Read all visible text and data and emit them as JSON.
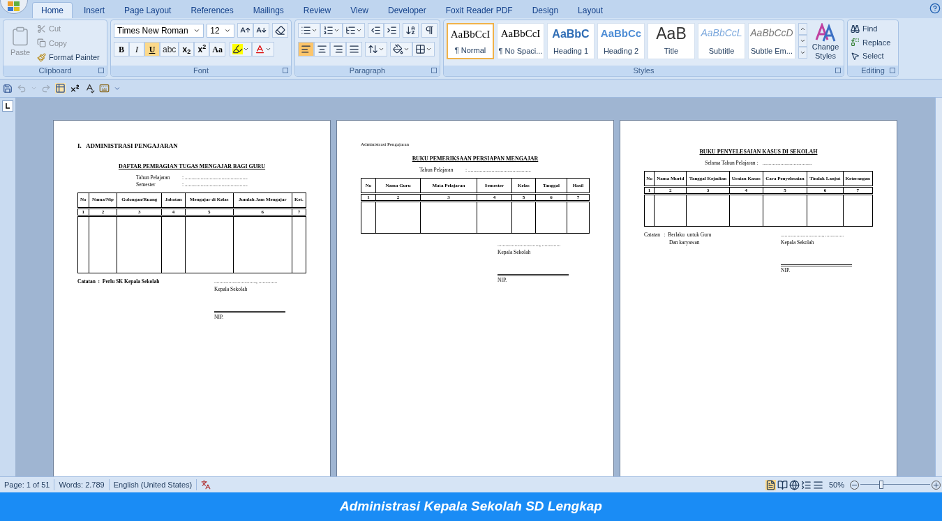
{
  "tabs": [
    {
      "label": "Home",
      "selected": true
    },
    {
      "label": "Insert",
      "selected": false
    },
    {
      "label": "Page Layout",
      "selected": false
    },
    {
      "label": "References",
      "selected": false
    },
    {
      "label": "Mailings",
      "selected": false
    },
    {
      "label": "Review",
      "selected": false
    },
    {
      "label": "View",
      "selected": false
    },
    {
      "label": "Developer",
      "selected": false
    },
    {
      "label": "Foxit Reader PDF",
      "selected": false
    },
    {
      "label": "Design",
      "selected": false
    },
    {
      "label": "Layout",
      "selected": false
    }
  ],
  "clipboard": {
    "paste": "Paste",
    "cut": "Cut",
    "copy": "Copy",
    "format_painter": "Format Painter",
    "label": "Clipboard"
  },
  "font": {
    "font_name": "Times New Roman",
    "font_size": "12",
    "label": "Font",
    "buttons": [
      {
        "kind": "bold",
        "label": "B",
        "selected": false
      },
      {
        "kind": "italic",
        "label": "I",
        "selected": false
      },
      {
        "kind": "underline",
        "label": "U",
        "selected": true
      },
      {
        "kind": "strike",
        "label": "abc",
        "selected": false
      },
      {
        "kind": "sub",
        "label": "x$_{2}$",
        "selected": false
      },
      {
        "kind": "sup",
        "label": "x$^{2}$",
        "selected": false
      },
      {
        "kind": "case",
        "label": "Aa",
        "selected": false
      }
    ]
  },
  "paragraph": {
    "label": "Paragraph",
    "alignments": [
      {
        "kind": "left",
        "selected": true
      },
      {
        "kind": "center",
        "selected": false
      },
      {
        "kind": "right",
        "selected": false
      },
      {
        "kind": "justify",
        "selected": false
      }
    ]
  },
  "styles": {
    "label": "Styles",
    "items": [
      {
        "kind": "normal",
        "preview": "AaBbCcI",
        "name": "¶ Normal",
        "selected": true
      },
      {
        "kind": "normal",
        "preview": "AaBbCcI",
        "name": "¶ No Spaci...",
        "selected": false
      },
      {
        "kind": "heading1",
        "preview": "AaBbC",
        "name": "Heading 1",
        "selected": false
      },
      {
        "kind": "heading2",
        "preview": "AaBbCc",
        "name": "Heading 2",
        "selected": false
      },
      {
        "kind": "title",
        "preview": "AaB",
        "name": "Title",
        "selected": false
      },
      {
        "kind": "subtitle",
        "preview": "AaBbCcL",
        "name": "Subtitle",
        "selected": false
      },
      {
        "kind": "emphasis",
        "preview": "AaBbCcD",
        "name": "Subtle Em...",
        "selected": false
      }
    ],
    "change_styles": "Change Styles"
  },
  "editing": {
    "label": "Editing",
    "find": "Find",
    "replace": "Replace",
    "select": "Select"
  },
  "pages": [
    {
      "section_heading": "I.   ADMINISTRASI PENGAJARAN",
      "title": "DAFTAR PEMBAGIAN TUGAS MENGAJAR BAGI GURU",
      "fields": [
        {
          "label": "Tahun Pelajaran",
          "value": ": ................................................"
        },
        {
          "label": "Semester",
          "value": ": ................................................"
        }
      ],
      "table": {
        "columns": [
          "No",
          "Nama/Nip",
          "Golongan/Ruang",
          "Jabatan",
          "Mengajar di Kelas",
          "Jumlah Jam Mengajar",
          "Ket."
        ],
        "numbers": [
          "1",
          "2",
          "3",
          "4",
          "5",
          "6",
          "7"
        ],
        "tall": true
      },
      "note": [
        "Catatan  :  Perlu SK Kepala Sekolah"
      ],
      "signature": {
        "place_date": "................................, ..............",
        "role": "Kepala Sekolah",
        "nip": "NIP."
      }
    },
    {
      "header_note": "Administrasi Pengajaran",
      "title": "BUKU PEMERIKSAAN PERSIAPAN MENGAJAR",
      "fields": [
        {
          "label": "Tahun Pelajaran",
          "value": ": ................................................"
        }
      ],
      "table": {
        "columns": [
          "No",
          "Nama Guru",
          "Mata Pelajaran",
          "Semester",
          "Kelas",
          "Tanggal",
          "Hasil"
        ],
        "numbers": [
          "1",
          "2",
          "3",
          "4",
          "5",
          "6",
          "7"
        ],
        "tall": false
      },
      "signature": {
        "place_date": "................................, ..............",
        "role": "Kepala Sekolah",
        "nip": "NIP."
      }
    },
    {
      "title": "BUKU PENYELESAIAN KASUS DI SEKOLAH",
      "fields": [
        {
          "label": "Selama Tahun Pelajaran :",
          "value": "......................................"
        }
      ],
      "table": {
        "columns": [
          "No",
          "Nama Murid",
          "Tanggal Kejadian",
          "Uraian Kasus",
          "Cara Penyelesaian",
          "Tindak Lanjut",
          "Keterangan"
        ],
        "numbers": [
          "1",
          "2",
          "3",
          "4",
          "5",
          "6",
          "7"
        ],
        "tall": false
      },
      "note": [
        "Catatan   :  Berlaku  untuk Guru",
        "Dan karyawan"
      ],
      "signature": {
        "place_date": "................................, ..............",
        "role": "Kepala Sekolah",
        "nip": "NIP."
      }
    }
  ],
  "status_bar": {
    "page": "Page: 1 of 51",
    "words": "Words: 2.789",
    "language": "English (United States)",
    "zoom": "50%",
    "zoom_slider": {
      "level": 0.3
    }
  },
  "caption": "Administrasi Kepala Sekolah SD Lengkap"
}
